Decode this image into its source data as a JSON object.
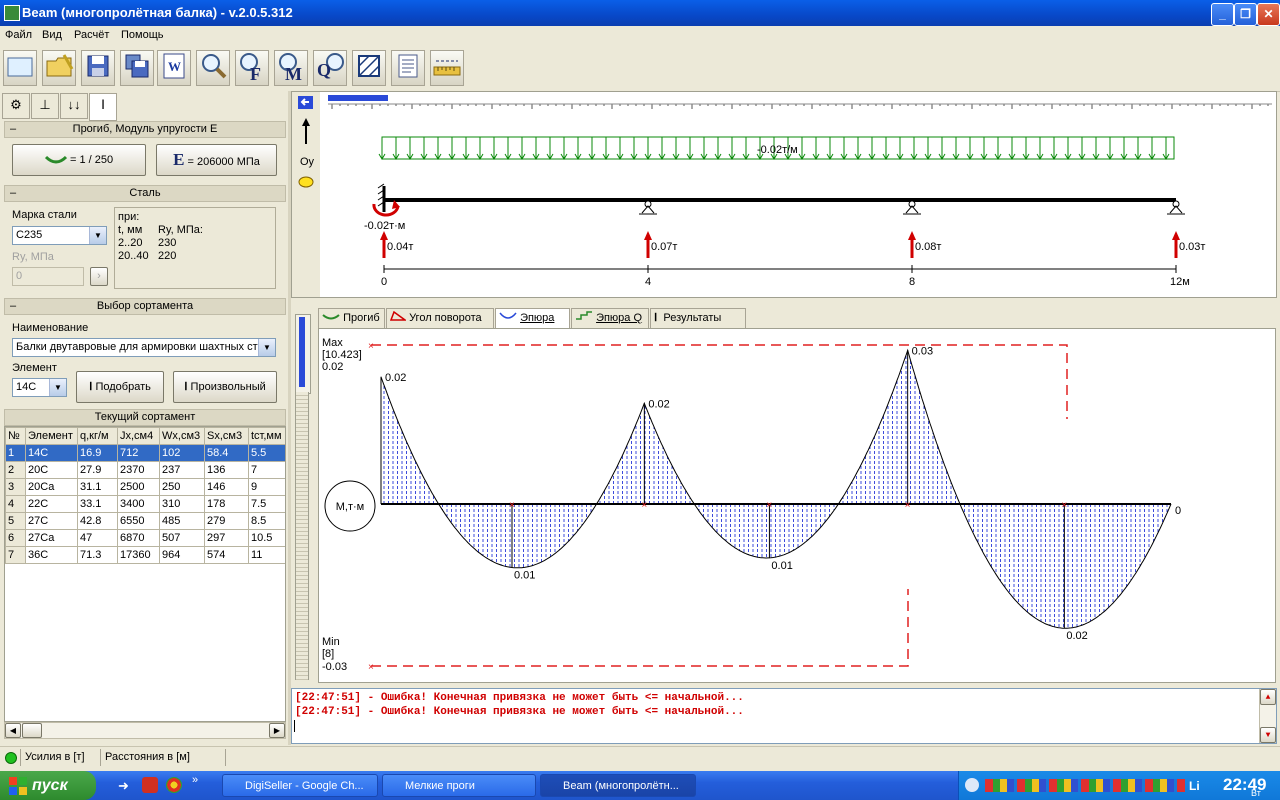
{
  "window": {
    "title": "Beam (многопролётная балка) - v.2.0.5.312"
  },
  "menu": [
    "Файл",
    "Вид",
    "Расчёт",
    "Помощь"
  ],
  "toolbar_icons": [
    "new-icon",
    "open-icon",
    "save-icon",
    "save-as-icon",
    "word-icon",
    "zoom-icon",
    "force-icon",
    "moment-icon",
    "query-icon",
    "hatch-icon",
    "report-icon",
    "ruler-icon"
  ],
  "toolbar_letters": {
    "F": "F",
    "M": "M",
    "Q": "Q"
  },
  "left": {
    "sec_deflection": "Прогиб, Модуль упругости E",
    "deflection_value": "= 1 / 250",
    "e_letter": "E",
    "modulus_value": "= 206000 МПа",
    "sec_steel": "Сталь",
    "steel_grade_label": "Марка стали",
    "steel_grade_value": "С235",
    "ry_label": "Ry, МПа",
    "ry_value": "0",
    "ry_table": {
      "pri": "при:",
      "t_head": "t, мм",
      "ry_head": "Ry, МПа:",
      "r1_t": "2..20",
      "r1_ry": "230",
      "r2_t": "20..40",
      "r2_ry": "220"
    },
    "sec_profile": "Выбор сортамента",
    "name_label": "Наименование",
    "name_value": "Балки двутавровые для армировки шахтных ст",
    "element_label": "Элемент",
    "element_value": "14С",
    "select_button": "Подобрать",
    "custom_button": "Произвольный",
    "sec_current": "Текущий сортамент",
    "table": {
      "headers": [
        "№",
        "Элемент",
        "q,кг/м",
        "Jx,см4",
        "Wx,см3",
        "Sx,см3",
        "tст,мм"
      ],
      "rows": [
        [
          "1",
          "14С",
          "16.9",
          "712",
          "102",
          "58.4",
          "5.5"
        ],
        [
          "2",
          "20С",
          "27.9",
          "2370",
          "237",
          "136",
          "7"
        ],
        [
          "3",
          "20Са",
          "31.1",
          "2500",
          "250",
          "146",
          "9"
        ],
        [
          "4",
          "22С",
          "33.1",
          "3400",
          "310",
          "178",
          "7.5"
        ],
        [
          "5",
          "27С",
          "42.8",
          "6550",
          "485",
          "279",
          "8.5"
        ],
        [
          "6",
          "27Са",
          "47",
          "6870",
          "507",
          "297",
          "10.5"
        ],
        [
          "7",
          "36С",
          "71.3",
          "17360",
          "964",
          "574",
          "11"
        ]
      ]
    }
  },
  "schema": {
    "oy_label": "Oy",
    "distributed_load": "-0.02т/м",
    "moment_label": "-0.02т·м",
    "reactions": [
      "0.04т",
      "0.07т",
      "0.08т",
      "0.03т"
    ],
    "axis_marks": [
      "0",
      "4",
      "8",
      "12м"
    ]
  },
  "tabs": [
    "Прогиб",
    "Угол поворота",
    "Эпюра M",
    "Эпюра Q",
    "Результаты"
  ],
  "active_tab": "Эпюра M",
  "plot": {
    "max_label": "Max",
    "max_pos": "[10.423]",
    "max_value": "0.02",
    "min_label": "Min",
    "min_pos": "[8]",
    "min_value": "-0.03",
    "unit_circle": "M,т·м",
    "peak_labels": [
      "0.02",
      "0.02",
      "0.03",
      "0"
    ],
    "sag_labels": [
      "0.01",
      "0.01",
      "0.02"
    ]
  },
  "log": [
    "[22:47:51] - Ошибка! Конечная привязка не может быть <= начальной...",
    "[22:47:51] - Ошибка! Конечная привязка не может быть <= начальной..."
  ],
  "status": {
    "forces": "Усилия в [т]",
    "distances": "Расстояния в [м]"
  },
  "taskbar": {
    "start": "пуск",
    "tasks": [
      "DigiSeller - Google Ch...",
      "Мелкие проги",
      "Beam (многопролётн..."
    ],
    "clock": "22:49",
    "clock_sub": "Вт"
  },
  "colors": {
    "selection": "#316ac5",
    "error_text": "#d00000",
    "load_green": "#0a8a0a",
    "reaction_red": "#d00000",
    "hatch_blue": "#2a3ad8"
  }
}
